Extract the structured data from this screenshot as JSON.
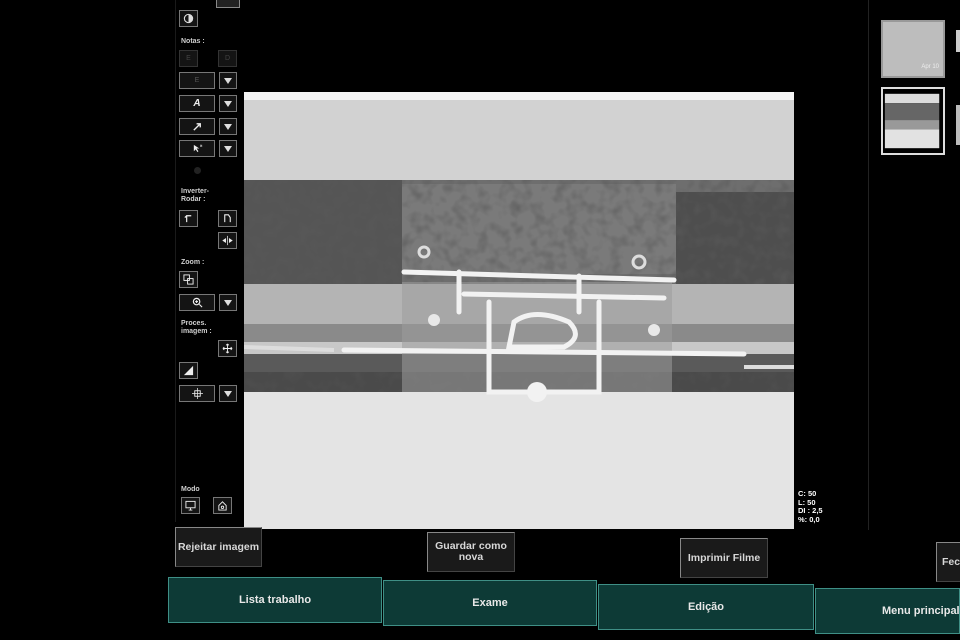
{
  "toolbar": {
    "notes_label": "Notas :",
    "notes_left": "E",
    "notes_right": "D",
    "text_tool": "E",
    "font_tool": "A",
    "invert_rotate_label": "Inverter-\nRodar :",
    "zoom_label": "Zoom :",
    "process_label": "Proces.\nimagem :",
    "mode_label": "Modo"
  },
  "overlay": {
    "line1": "C: 50",
    "line2": "L: 50",
    "line3": "DI : 2,5",
    "line4": "%: 0,0"
  },
  "thumbs": {
    "first_text": "Apr 10"
  },
  "actions": {
    "reject": "Rejeitar imagem",
    "save_new": "Guardar como nova",
    "print": "Imprimir Filme",
    "close": "Fec"
  },
  "tabs": {
    "worklist": "Lista trabalho",
    "exam": "Exame",
    "edit": "Edição",
    "main_menu": "Menu principal"
  },
  "colors": {
    "tab_bg": "#0d3a36",
    "tab_border": "#3f8f86"
  }
}
